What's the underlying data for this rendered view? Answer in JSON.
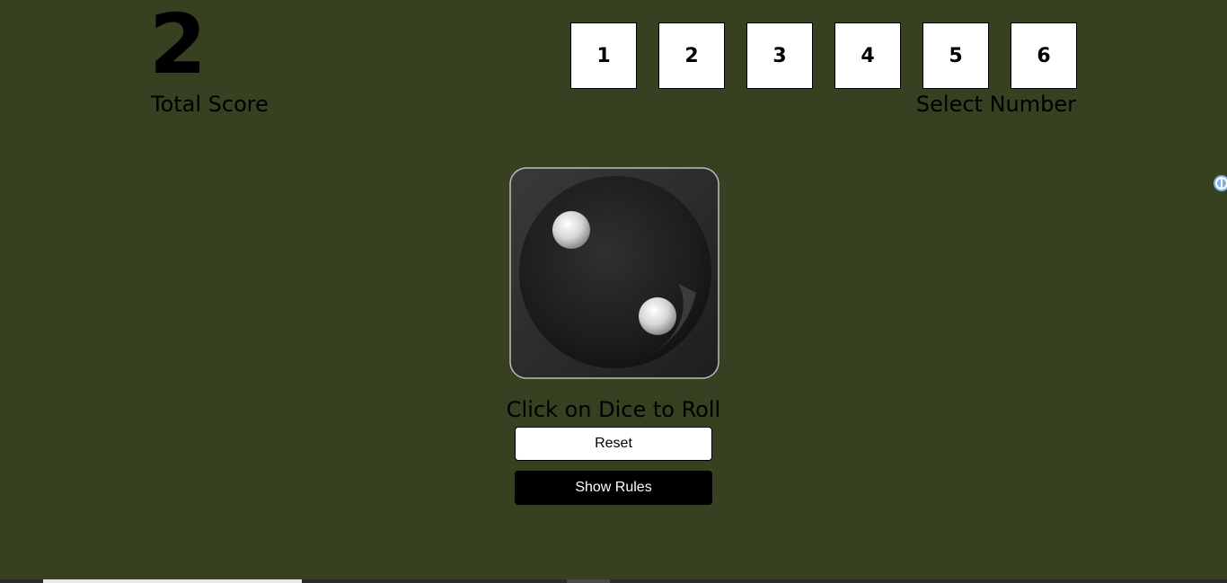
{
  "score": {
    "value": "2",
    "label": "Total Score"
  },
  "number_selector": {
    "options": [
      "1",
      "2",
      "3",
      "4",
      "5",
      "6"
    ],
    "label": "Select Number"
  },
  "dice": {
    "face_value": 2,
    "icon": "dice-two-icon"
  },
  "instructions": {
    "roll_text": "Click on Dice to Roll"
  },
  "buttons": {
    "reset_label": "Reset",
    "rules_label": "Show Rules"
  },
  "colors": {
    "background": "#374020",
    "box": "#ffffff",
    "rules_button": "#000000"
  }
}
